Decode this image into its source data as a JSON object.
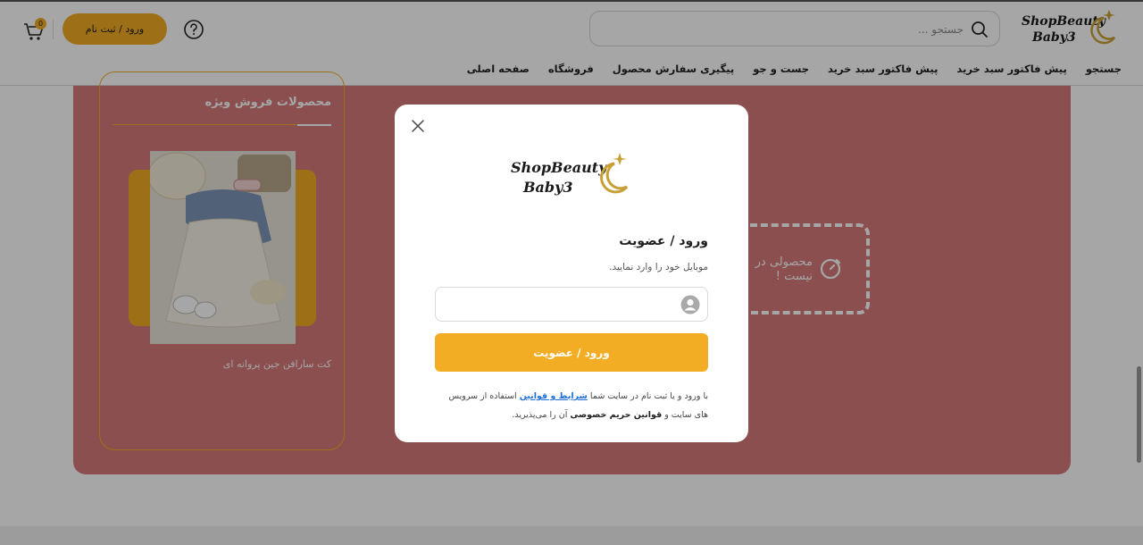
{
  "header": {
    "logo_text_line1": "ShopBeauty",
    "logo_text_line2": "Baby3",
    "search": {
      "placeholder": "جستجو ..."
    },
    "login_button": "ورود / ثبت نام",
    "cart_count": "0",
    "nav": [
      "صفحه اصلی",
      "فروشگاه",
      "پیگیری سفارش محصول",
      "جست و جو",
      "پیش فاکتور سبد خرید",
      "پیش فاکتور سبد خرید",
      "جستجو"
    ]
  },
  "page": {
    "special_title": "محصولات فروش ویژه",
    "product_name": "کت سارافن جین پروانه ای",
    "empty_text": "محصولی در نیست !"
  },
  "modal": {
    "title": "ورود / عضویت",
    "subtitle": "موبایل خود را وارد نمایید.",
    "phone_value": "",
    "submit_label": "ورود / عضویت",
    "terms_part1": "با ورود و یا ثبت نام در سایت شما ",
    "terms_link": "شرایط و قوانین",
    "terms_part2": " استفاده از سرویس های سایت و ",
    "terms_bold": "قوانین حریم خصوصی",
    "terms_part3": " آن را می‌پذیرید."
  },
  "colors": {
    "accent": "#f2ad24",
    "panel": "#d77a7a",
    "link": "#1e6fd9"
  }
}
